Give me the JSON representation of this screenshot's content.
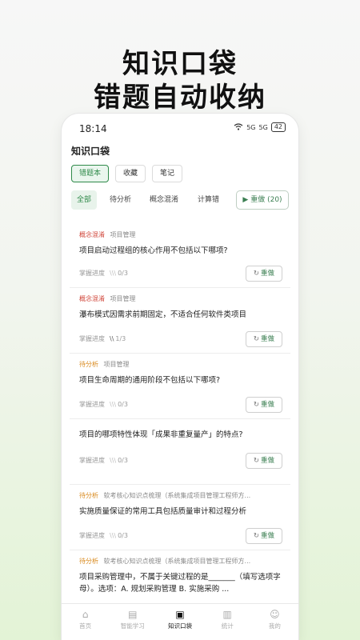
{
  "headline": {
    "line1": "知识口袋",
    "line2": "错题自动收纳"
  },
  "status": {
    "time": "18:14",
    "net1": "5G",
    "net2": "5G",
    "battery": "42"
  },
  "page": {
    "title": "知识口袋"
  },
  "segments": [
    {
      "label": "错题本",
      "active": true
    },
    {
      "label": "收藏"
    },
    {
      "label": "笔记"
    }
  ],
  "tabs": [
    {
      "label": "全部",
      "active": true
    },
    {
      "label": "待分析"
    },
    {
      "label": "概念混淆"
    },
    {
      "label": "计算错"
    }
  ],
  "redo_all": {
    "label": "重做 (20)",
    "icon": "play-icon"
  },
  "cards": [
    {
      "tag": "概念混淆",
      "tag_color": "#d0463a",
      "subject": "项目管理",
      "question": "项目启动过程组的核心作用不包括以下哪项?",
      "progress_label": "掌握进度",
      "progress": "0/3",
      "redo": "重做"
    },
    {
      "tag": "概念混淆",
      "tag_color": "#d0463a",
      "subject": "项目管理",
      "question": "瀑布模式因需求前期固定，不适合任何软件类项目",
      "progress_label": "掌握进度",
      "progress": "1/3",
      "redo": "重做"
    },
    {
      "tag": "待分析",
      "tag_color": "#d98a1e",
      "subject": "项目管理",
      "question": "项目生命周期的通用阶段不包括以下哪项?",
      "progress_label": "掌握进度",
      "progress": "0/3",
      "redo": "重做"
    },
    {
      "tag": "",
      "tag_color": "",
      "subject": "",
      "question": "项目的哪项特性体现「成果非重复量产」的特点?",
      "progress_label": "掌握进度",
      "progress": "0/3",
      "redo": "重做"
    },
    {
      "tag": "待分析",
      "tag_color": "#d98a1e",
      "subject": "软考核心知识点梳理（系统集成项目管理工程师方...",
      "question": "实施质量保证的常用工具包括质量审计和过程分析",
      "progress_label": "掌握进度",
      "progress": "0/3",
      "redo": "重做"
    },
    {
      "tag": "待分析",
      "tag_color": "#d98a1e",
      "subject": "软考核心知识点梳理（系统集成项目管理工程师方...",
      "question": "项目采购管理中，不属于关键过程的是_______（填写选项字母）。选项：A. 规划采购管理 B. 实施采购 ...",
      "progress_label": "",
      "progress": "",
      "redo": ""
    }
  ],
  "nav": [
    {
      "label": "首页",
      "icon": "home-icon"
    },
    {
      "label": "智能学习",
      "icon": "book-icon"
    },
    {
      "label": "知识口袋",
      "icon": "bookmark-icon",
      "active": true
    },
    {
      "label": "统计",
      "icon": "chart-icon"
    },
    {
      "label": "我的",
      "icon": "person-icon"
    }
  ]
}
